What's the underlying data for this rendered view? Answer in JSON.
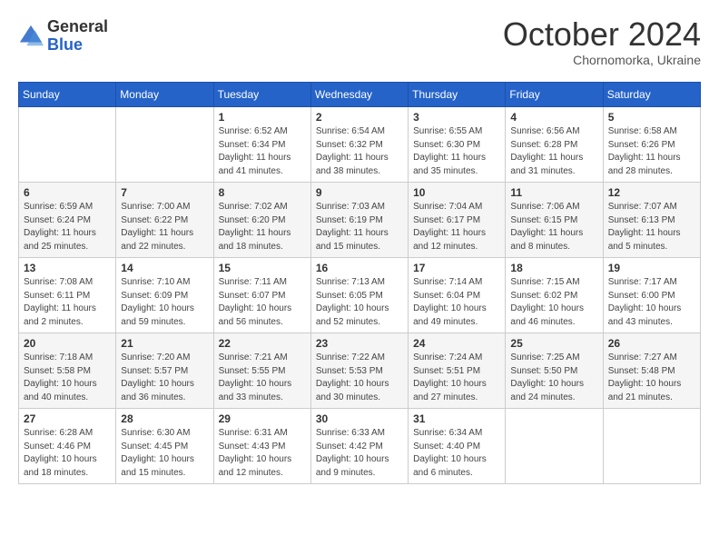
{
  "header": {
    "logo": {
      "general": "General",
      "blue": "Blue"
    },
    "month": "October 2024",
    "location": "Chornomorka, Ukraine"
  },
  "weekdays": [
    "Sunday",
    "Monday",
    "Tuesday",
    "Wednesday",
    "Thursday",
    "Friday",
    "Saturday"
  ],
  "weeks": [
    [
      {
        "day": "",
        "info": ""
      },
      {
        "day": "",
        "info": ""
      },
      {
        "day": "1",
        "info": "Sunrise: 6:52 AM\nSunset: 6:34 PM\nDaylight: 11 hours and 41 minutes."
      },
      {
        "day": "2",
        "info": "Sunrise: 6:54 AM\nSunset: 6:32 PM\nDaylight: 11 hours and 38 minutes."
      },
      {
        "day": "3",
        "info": "Sunrise: 6:55 AM\nSunset: 6:30 PM\nDaylight: 11 hours and 35 minutes."
      },
      {
        "day": "4",
        "info": "Sunrise: 6:56 AM\nSunset: 6:28 PM\nDaylight: 11 hours and 31 minutes."
      },
      {
        "day": "5",
        "info": "Sunrise: 6:58 AM\nSunset: 6:26 PM\nDaylight: 11 hours and 28 minutes."
      }
    ],
    [
      {
        "day": "6",
        "info": "Sunrise: 6:59 AM\nSunset: 6:24 PM\nDaylight: 11 hours and 25 minutes."
      },
      {
        "day": "7",
        "info": "Sunrise: 7:00 AM\nSunset: 6:22 PM\nDaylight: 11 hours and 22 minutes."
      },
      {
        "day": "8",
        "info": "Sunrise: 7:02 AM\nSunset: 6:20 PM\nDaylight: 11 hours and 18 minutes."
      },
      {
        "day": "9",
        "info": "Sunrise: 7:03 AM\nSunset: 6:19 PM\nDaylight: 11 hours and 15 minutes."
      },
      {
        "day": "10",
        "info": "Sunrise: 7:04 AM\nSunset: 6:17 PM\nDaylight: 11 hours and 12 minutes."
      },
      {
        "day": "11",
        "info": "Sunrise: 7:06 AM\nSunset: 6:15 PM\nDaylight: 11 hours and 8 minutes."
      },
      {
        "day": "12",
        "info": "Sunrise: 7:07 AM\nSunset: 6:13 PM\nDaylight: 11 hours and 5 minutes."
      }
    ],
    [
      {
        "day": "13",
        "info": "Sunrise: 7:08 AM\nSunset: 6:11 PM\nDaylight: 11 hours and 2 minutes."
      },
      {
        "day": "14",
        "info": "Sunrise: 7:10 AM\nSunset: 6:09 PM\nDaylight: 10 hours and 59 minutes."
      },
      {
        "day": "15",
        "info": "Sunrise: 7:11 AM\nSunset: 6:07 PM\nDaylight: 10 hours and 56 minutes."
      },
      {
        "day": "16",
        "info": "Sunrise: 7:13 AM\nSunset: 6:05 PM\nDaylight: 10 hours and 52 minutes."
      },
      {
        "day": "17",
        "info": "Sunrise: 7:14 AM\nSunset: 6:04 PM\nDaylight: 10 hours and 49 minutes."
      },
      {
        "day": "18",
        "info": "Sunrise: 7:15 AM\nSunset: 6:02 PM\nDaylight: 10 hours and 46 minutes."
      },
      {
        "day": "19",
        "info": "Sunrise: 7:17 AM\nSunset: 6:00 PM\nDaylight: 10 hours and 43 minutes."
      }
    ],
    [
      {
        "day": "20",
        "info": "Sunrise: 7:18 AM\nSunset: 5:58 PM\nDaylight: 10 hours and 40 minutes."
      },
      {
        "day": "21",
        "info": "Sunrise: 7:20 AM\nSunset: 5:57 PM\nDaylight: 10 hours and 36 minutes."
      },
      {
        "day": "22",
        "info": "Sunrise: 7:21 AM\nSunset: 5:55 PM\nDaylight: 10 hours and 33 minutes."
      },
      {
        "day": "23",
        "info": "Sunrise: 7:22 AM\nSunset: 5:53 PM\nDaylight: 10 hours and 30 minutes."
      },
      {
        "day": "24",
        "info": "Sunrise: 7:24 AM\nSunset: 5:51 PM\nDaylight: 10 hours and 27 minutes."
      },
      {
        "day": "25",
        "info": "Sunrise: 7:25 AM\nSunset: 5:50 PM\nDaylight: 10 hours and 24 minutes."
      },
      {
        "day": "26",
        "info": "Sunrise: 7:27 AM\nSunset: 5:48 PM\nDaylight: 10 hours and 21 minutes."
      }
    ],
    [
      {
        "day": "27",
        "info": "Sunrise: 6:28 AM\nSunset: 4:46 PM\nDaylight: 10 hours and 18 minutes."
      },
      {
        "day": "28",
        "info": "Sunrise: 6:30 AM\nSunset: 4:45 PM\nDaylight: 10 hours and 15 minutes."
      },
      {
        "day": "29",
        "info": "Sunrise: 6:31 AM\nSunset: 4:43 PM\nDaylight: 10 hours and 12 minutes."
      },
      {
        "day": "30",
        "info": "Sunrise: 6:33 AM\nSunset: 4:42 PM\nDaylight: 10 hours and 9 minutes."
      },
      {
        "day": "31",
        "info": "Sunrise: 6:34 AM\nSunset: 4:40 PM\nDaylight: 10 hours and 6 minutes."
      },
      {
        "day": "",
        "info": ""
      },
      {
        "day": "",
        "info": ""
      }
    ]
  ]
}
